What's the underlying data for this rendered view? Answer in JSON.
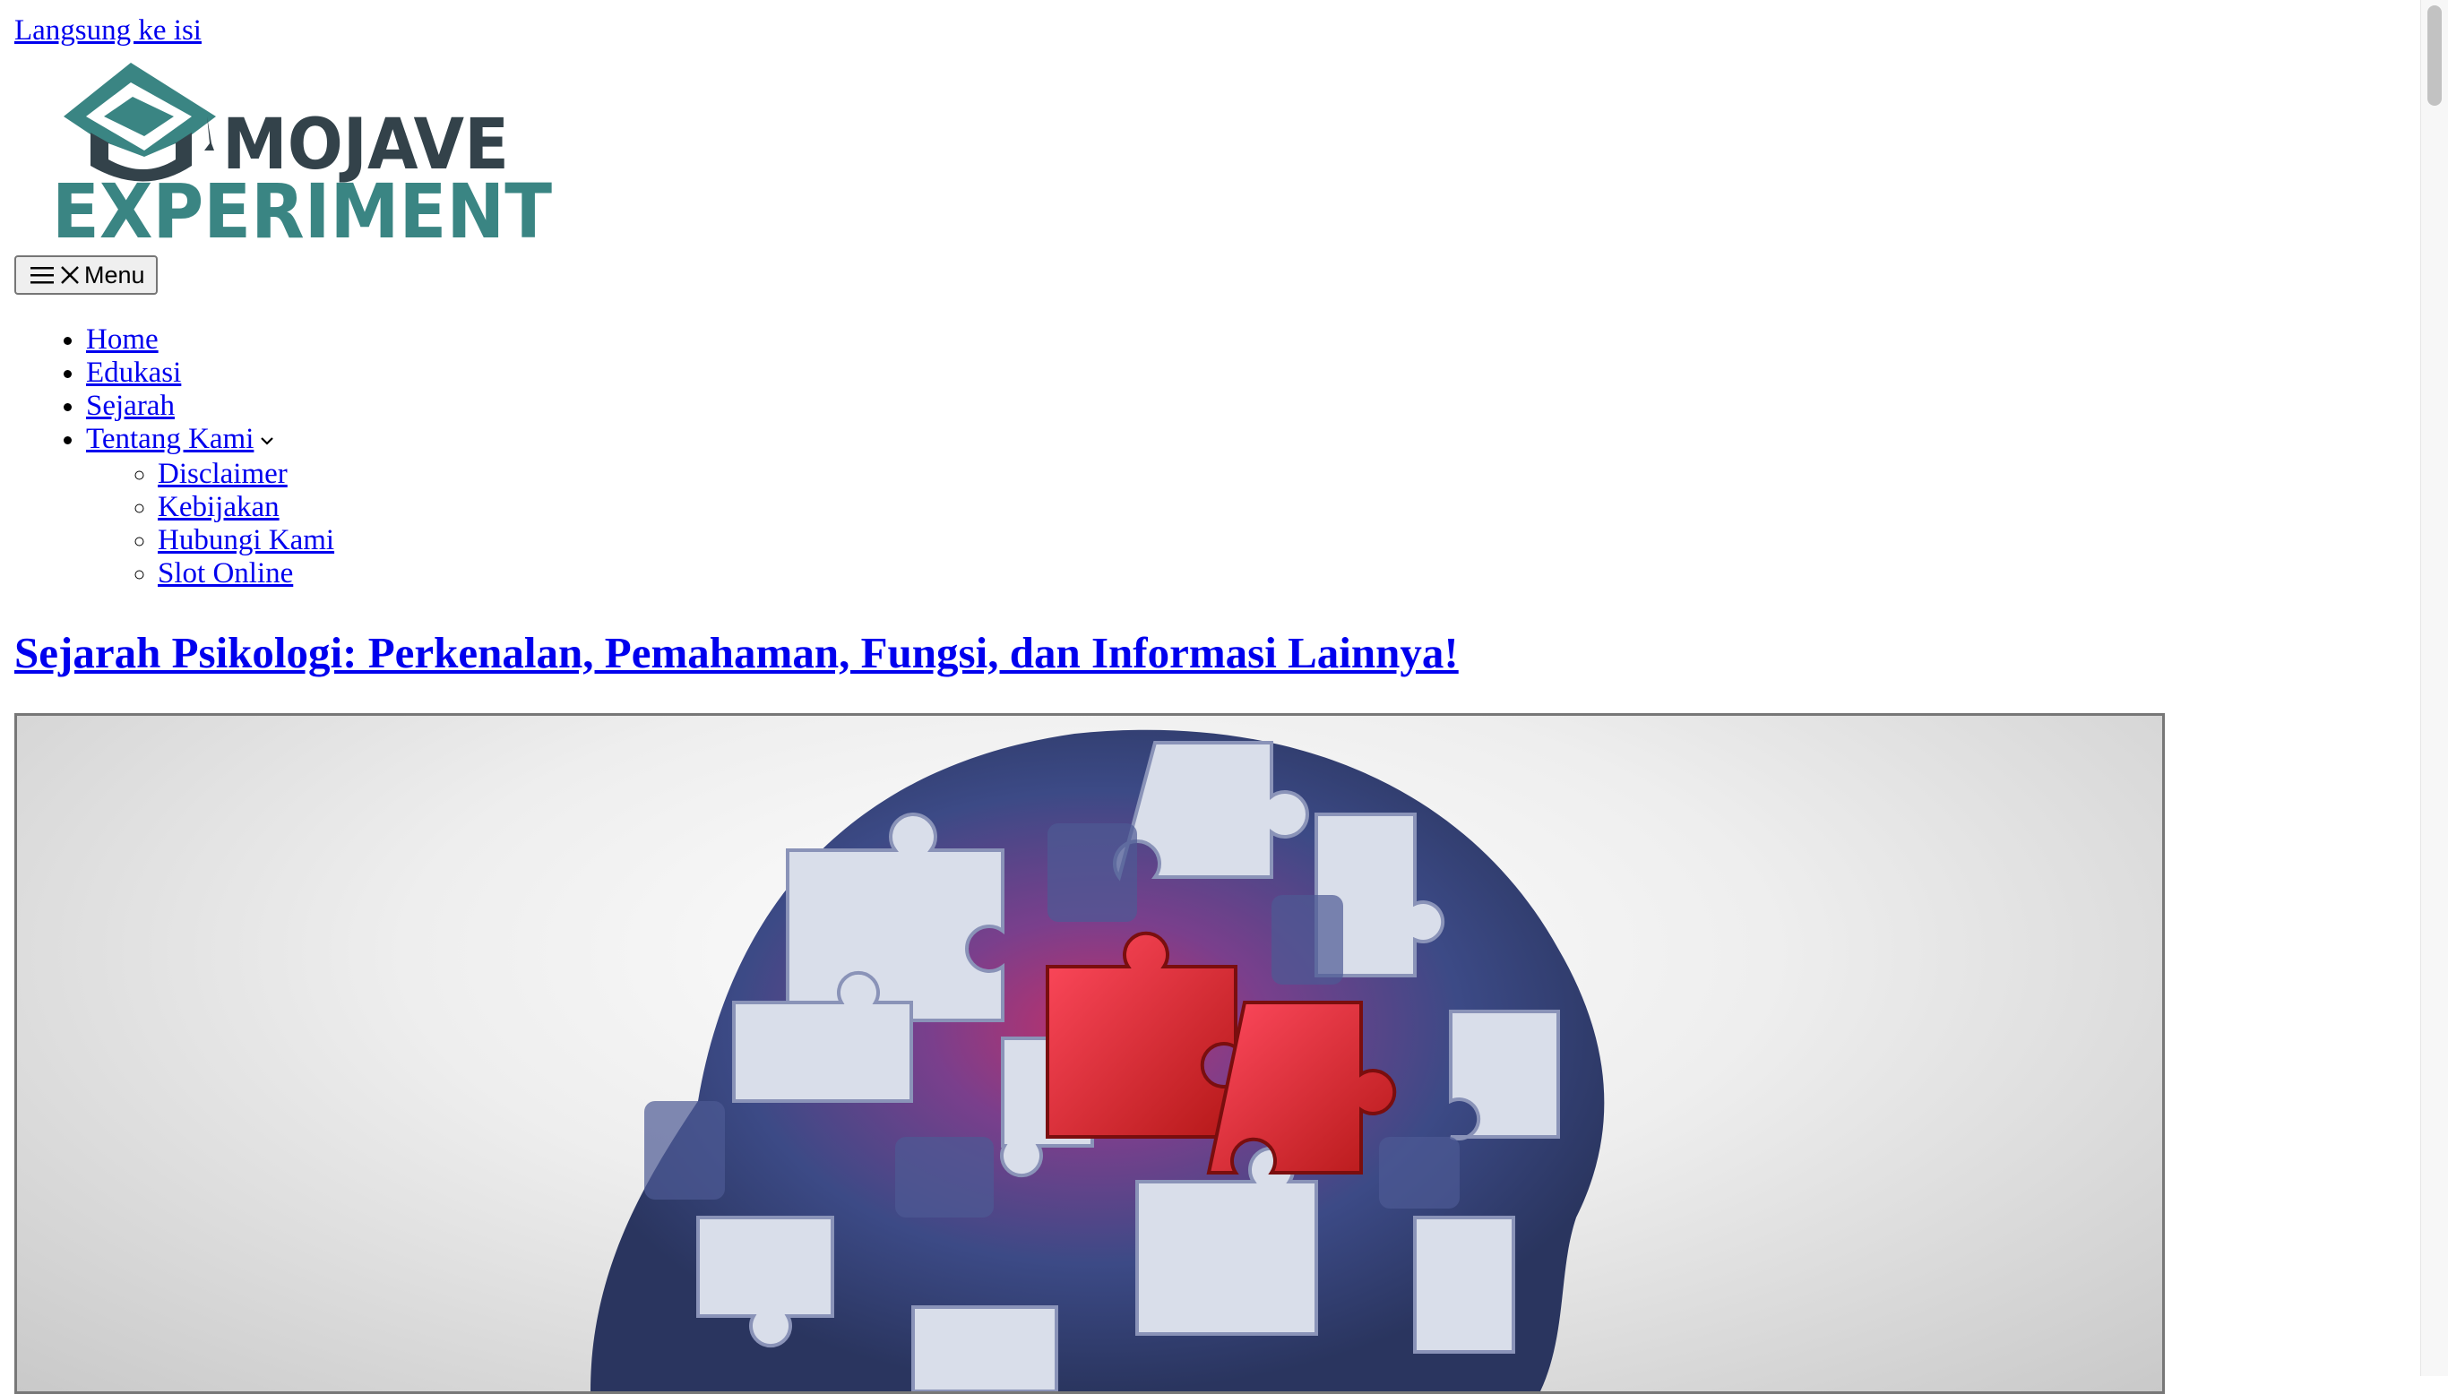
{
  "skip_link": "Langsung ke isi",
  "logo": {
    "line1": "MOJAVE",
    "line2": "EXPERIMENT",
    "colors": {
      "dark": "#33424a",
      "teal": "#3a8583"
    }
  },
  "menu_toggle": {
    "label": "Menu",
    "icons": [
      "hamburger-icon",
      "close-icon"
    ]
  },
  "nav": {
    "items": [
      {
        "label": "Home"
      },
      {
        "label": "Edukasi"
      },
      {
        "label": "Sejarah"
      },
      {
        "label": "Tentang Kami",
        "icon": "chevron-down-icon"
      }
    ],
    "submenu": [
      {
        "label": "Disclaimer"
      },
      {
        "label": "Kebijakan"
      },
      {
        "label": "Hubungi Kami"
      },
      {
        "label": "Slot Online"
      }
    ]
  },
  "article": {
    "title": "Sejarah Psikologi: Perkenalan, Pemahaman, Fungsi, dan Informasi Lainnya!"
  },
  "colors": {
    "link": "#0000ee"
  }
}
